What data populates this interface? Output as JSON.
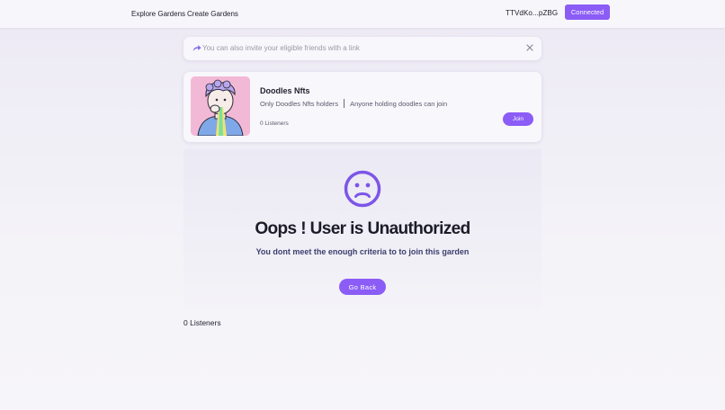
{
  "nav": {
    "explore_label": "Explore Gardens",
    "create_label": "Create Gardens",
    "wallet_address": "TTVdKo...pZBG",
    "connected_label": "Connected"
  },
  "invite": {
    "text": "You can also invite your eligible friends with a link",
    "icons": [
      "share-arrow-icon",
      "close-icon"
    ]
  },
  "garden": {
    "name": "Doodles Nfts",
    "criteria": "Only Doodles Nfts holders",
    "description": "Anyone holding doodles can join",
    "listeners": "0 Listeners",
    "join_label": "Join"
  },
  "unauthorized": {
    "icon": "sad-face-icon",
    "title": "Oops ! User is Unauthorized",
    "subtitle": "You dont meet the enough criteria to to join this garden",
    "go_back_label": "Go Back"
  },
  "footer": {
    "listeners": "0 Listeners"
  },
  "colors": {
    "accent": "#8b5cf6",
    "background": "#f0eef6",
    "avatar_bg": "#f2b9d6"
  }
}
